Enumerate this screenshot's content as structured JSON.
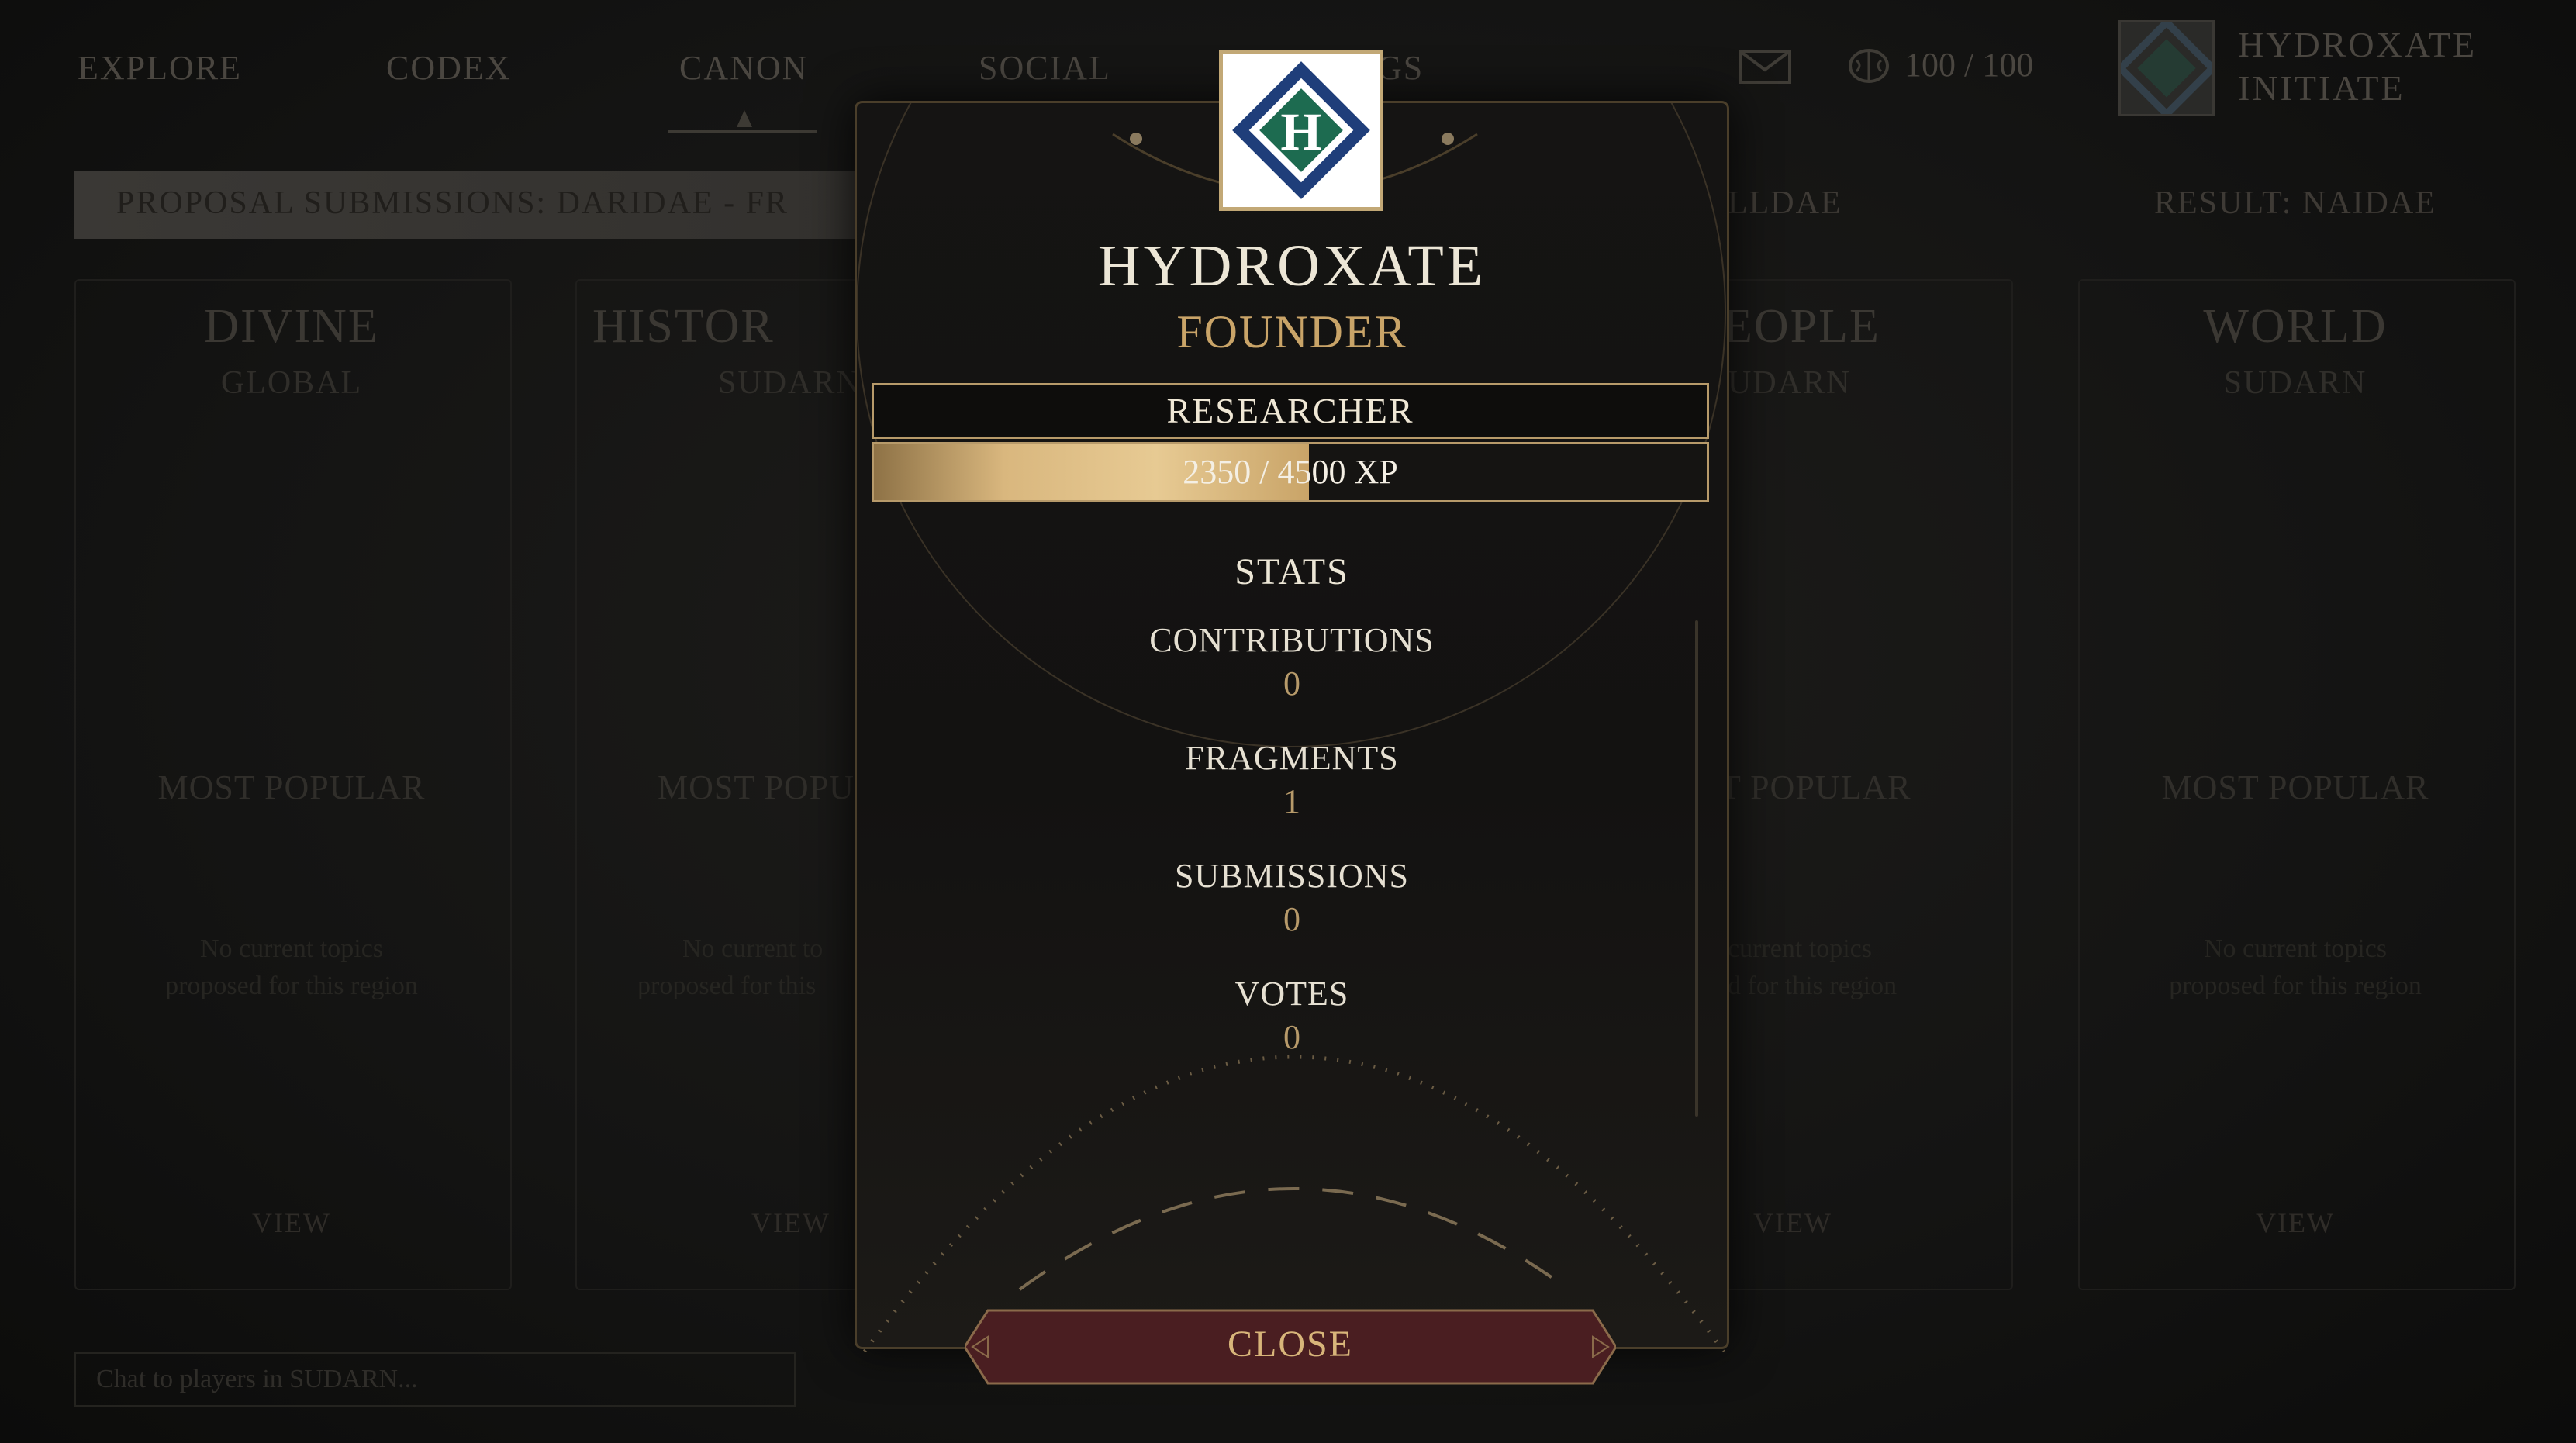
{
  "nav": {
    "items": [
      "EXPLORE",
      "CODEX",
      "CANON",
      "SOCIAL",
      "GS"
    ],
    "active": "CANON"
  },
  "hud": {
    "energy": "100 / 100",
    "username_line1": "HYDROXATE",
    "username_line2": "INITIATE"
  },
  "banner": {
    "text": "PROPOSAL SUBMISSIONS: DARIDAE - FR",
    "middle": "LLDAE",
    "result": "RESULT: NAIDAE"
  },
  "columns": [
    {
      "title": "DIVINE",
      "subtitle": "GLOBAL",
      "popular": "MOST POPULAR",
      "empty1": "No current topics",
      "empty2": "proposed for this region",
      "view": "VIEW"
    },
    {
      "title": "HISTOR",
      "subtitle": "SUDARN",
      "popular": "MOST POPU",
      "empty1": "No current to",
      "empty2": "proposed for this",
      "view": "VIEW"
    },
    {
      "title": "EOPLE",
      "subtitle": "UDARN",
      "popular": "T POPULAR",
      "empty1": "current topics",
      "empty2": "d for this region",
      "view": "VIEW"
    },
    {
      "title": "WORLD",
      "subtitle": "SUDARN",
      "popular": "MOST POPULAR",
      "empty1": "No current topics",
      "empty2": "proposed for this region",
      "view": "VIEW"
    }
  ],
  "chat": {
    "placeholder": "Chat to players in SUDARN..."
  },
  "profile": {
    "name": "HYDROXATE",
    "role": "FOUNDER",
    "rank": "RESEARCHER",
    "xp_current": 2350,
    "xp_max": 4500,
    "xp_label": "2350 / 4500 XP",
    "stats_title": "STATS",
    "stats": [
      {
        "label": "CONTRIBUTIONS",
        "value": "0"
      },
      {
        "label": "FRAGMENTS",
        "value": "1"
      },
      {
        "label": "SUBMISSIONS",
        "value": "0"
      },
      {
        "label": "VOTES",
        "value": "0"
      }
    ],
    "close_label": "CLOSE",
    "logo_letter": "H"
  },
  "colors": {
    "accent_gold": "#c9a468",
    "logo_blue": "#1f3e7a",
    "logo_green": "#1d6b50",
    "close_button": "#4a1e21"
  },
  "icons": {
    "mail": "mail-icon",
    "energy": "brain-icon"
  }
}
